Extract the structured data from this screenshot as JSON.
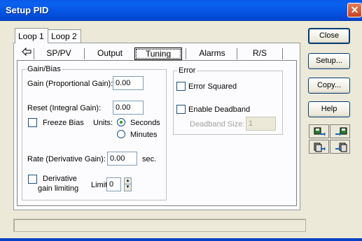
{
  "window": {
    "title": "Setup PID"
  },
  "outer_tabs": [
    "Loop 1",
    "Loop 2"
  ],
  "inner_tabs": [
    "SP/PV",
    "Output",
    "Tuning",
    "Alarms",
    "R/S"
  ],
  "gain_bias": {
    "title": "Gain/Bias",
    "gain_label": "Gain (Proportional Gain):",
    "gain_value": "0.00",
    "reset_label": "Reset (Integral Gain):",
    "reset_value": "0.00",
    "freeze_bias_label": "Freeze Bias",
    "units_label": "Units:",
    "units_seconds": "Seconds",
    "units_minutes": "Minutes",
    "rate_label": "Rate (Derivative Gain):",
    "rate_value": "0.00",
    "rate_unit": "sec.",
    "derivative_limit_line1": "Derivative",
    "derivative_limit_line2": "gain limiting",
    "limit_label": "Limit:",
    "limit_value": "0"
  },
  "error": {
    "title": "Error",
    "error_squared_label": "Error Squared",
    "enable_deadband_label": "Enable Deadband",
    "deadband_size_label": "Deadband Size:",
    "deadband_size_value": "1"
  },
  "buttons": {
    "close": "Close",
    "setup": "Setup...",
    "copy": "Copy...",
    "help": "Help"
  },
  "icons": [
    "export-left-icon",
    "import-right-icon",
    "copy-left-icon",
    "copy-right-icon"
  ],
  "colors": {
    "titlebar": "#0553e0",
    "dialog": "#ece9d8",
    "panel": "#fcfcfe"
  }
}
